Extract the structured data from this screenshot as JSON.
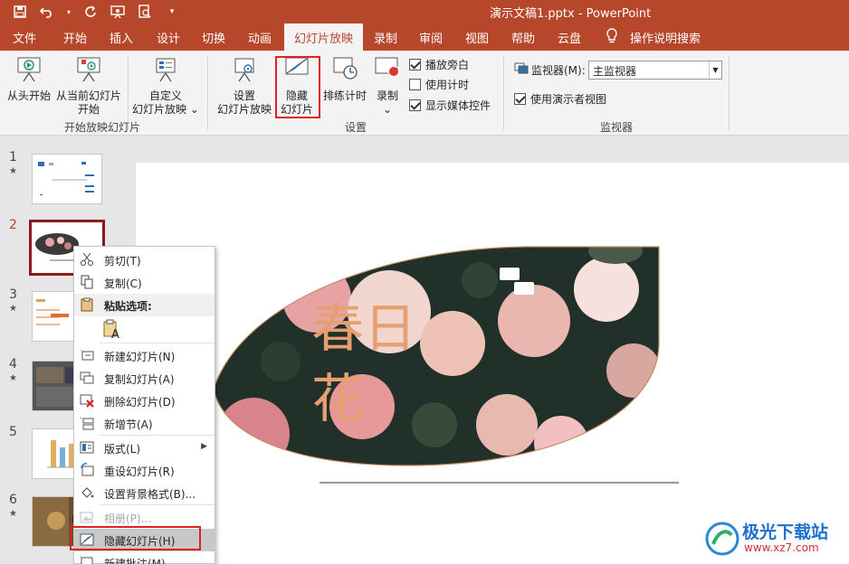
{
  "window": {
    "title": "演示文稿1.pptx  -  PowerPoint"
  },
  "qat": {
    "icons": [
      "save-icon",
      "undo-icon",
      "redo-icon",
      "present-icon",
      "print-preview-icon",
      "customize-icon"
    ]
  },
  "tabs": [
    "文件",
    "开始",
    "插入",
    "设计",
    "切换",
    "动画",
    "幻灯片放映",
    "录制",
    "审阅",
    "视图",
    "帮助",
    "云盘",
    "操作说明搜索"
  ],
  "active_tab": "幻灯片放映",
  "ribbon": {
    "start_group": {
      "label": "开始放映幻灯片",
      "from_beginning": "从头开始",
      "from_current_1": "从当前幻灯片",
      "from_current_2": "开始",
      "custom_1": "自定义",
      "custom_2": "幻灯片放映",
      "custom_arrow": "⌄"
    },
    "setup_group": {
      "label": "设置",
      "setup_1": "设置",
      "setup_2": "幻灯片放映",
      "hide_1": "隐藏",
      "hide_2": "幻灯片",
      "rehearse": "排练计时",
      "record": "录制",
      "record_arrow": "⌄",
      "play_narration": "播放旁白",
      "use_timings": "使用计时",
      "show_media_controls": "显示媒体控件"
    },
    "monitor_group": {
      "label": "监视器",
      "monitor_label": "监视器(M):",
      "monitor_value": "主监视器",
      "presenter_view": "使用演示者视图"
    }
  },
  "slides": [
    {
      "num": "1",
      "star": "★"
    },
    {
      "num": "2",
      "star": ""
    },
    {
      "num": "3",
      "star": "★"
    },
    {
      "num": "4",
      "star": "★"
    },
    {
      "num": "5",
      "star": ""
    },
    {
      "num": "6",
      "star": "★"
    }
  ],
  "slide_text": {
    "line1": "春日",
    "line2": "花"
  },
  "context_menu": {
    "cut": "剪切(T)",
    "copy": "复制(C)",
    "paste_options": "粘贴选项:",
    "new_slide": "新建幻灯片(N)",
    "duplicate_slide": "复制幻灯片(A)",
    "delete_slide": "删除幻灯片(D)",
    "new_section": "新增节(A)",
    "layout": "版式(L)",
    "reset_slide": "重设幻灯片(R)",
    "format_background": "设置背景格式(B)...",
    "photo_album": "相册(P)...",
    "hide_slide": "隐藏幻灯片(H)",
    "new_comment": "新建批注(M)"
  },
  "watermark": {
    "text": "极光下载站",
    "url": "www.xz7.com"
  },
  "colors": {
    "accent": "#b7472a",
    "highlight": "#e0201e"
  }
}
